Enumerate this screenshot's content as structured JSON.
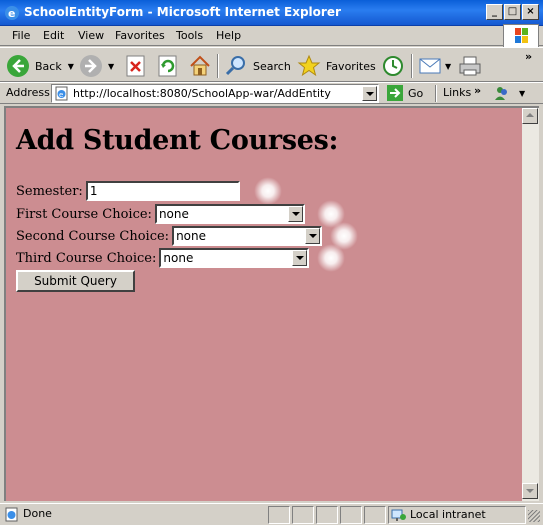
{
  "window": {
    "title": "SchoolEntityForm - Microsoft Internet Explorer",
    "minimize": "_",
    "maximize": "□",
    "close": "×"
  },
  "menu": [
    "File",
    "Edit",
    "View",
    "Favorites",
    "Tools",
    "Help"
  ],
  "toolbar": {
    "back": "Back",
    "search": "Search",
    "favorites": "Favorites"
  },
  "address": {
    "label": "Address",
    "url": "http://localhost:8080/SchoolApp-war/AddEntity",
    "go": "Go",
    "links": "Links"
  },
  "page": {
    "heading": "Add Student Courses:",
    "fields": {
      "semester": {
        "label": "Semester:",
        "value": "1"
      },
      "first": {
        "label": "First Course Choice:",
        "value": "none"
      },
      "second": {
        "label": "Second Course Choice:",
        "value": "none"
      },
      "third": {
        "label": "Third Course Choice:",
        "value": "none"
      }
    },
    "submit": "Submit Query"
  },
  "status": {
    "text": "Done",
    "zone": "Local intranet"
  },
  "colors": {
    "page_background": "#cc8d91",
    "titlebar": "#0a5fd8"
  }
}
